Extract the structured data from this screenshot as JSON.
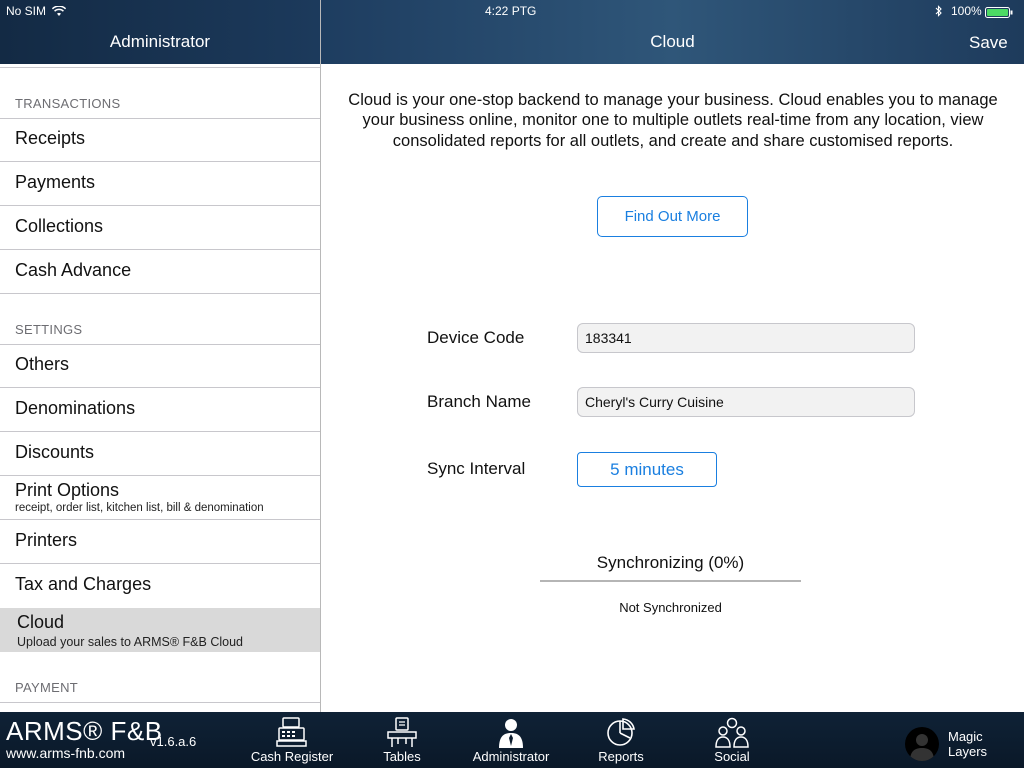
{
  "status": {
    "carrier": "No SIM",
    "time": "4:22 PTG",
    "battery": "100%"
  },
  "sidebar": {
    "title": "Administrator",
    "sections": [
      {
        "header": "TRANSACTIONS",
        "items": [
          "Receipts",
          "Payments",
          "Collections",
          "Cash Advance"
        ]
      },
      {
        "header": "SETTINGS",
        "items": [
          "Others",
          "Denominations",
          "Discounts"
        ]
      },
      {
        "header": "PAYMENT"
      }
    ],
    "print_options": {
      "label": "Print Options",
      "subtitle": "receipt, order list, kitchen list, bill & denomination"
    },
    "printers": "Printers",
    "tax": "Tax and Charges",
    "cloud": {
      "label": "Cloud",
      "subtitle": "Upload your sales to ARMS® F&B Cloud",
      "selected": true
    }
  },
  "main": {
    "title": "Cloud",
    "save_label": "Save",
    "description": "Cloud is your one-stop backend to manage your business. Cloud enables you to manage your business online, monitor one to multiple outlets real-time from any location, view consolidated reports for all outlets, and create and share customised reports.",
    "find_more_label": "Find Out More",
    "device_code_label": "Device Code",
    "device_code_value": "183341",
    "branch_name_label": "Branch Name",
    "branch_name_value": "Cheryl's Curry Cuisine",
    "sync_interval_label": "Sync Interval",
    "sync_interval_value": "5 minutes",
    "sync_title": "Synchronizing (0%)",
    "sync_progress": 0,
    "sync_status": "Not Synchronized"
  },
  "tabbar": {
    "brand": "ARMS® F&B",
    "url": "www.arms-fnb.com",
    "version": "v1.6.a.6",
    "tabs": [
      {
        "label": "Cash Register",
        "icon": "cash-register-icon"
      },
      {
        "label": "Tables",
        "icon": "tables-icon"
      },
      {
        "label": "Administrator",
        "icon": "administrator-icon"
      },
      {
        "label": "Reports",
        "icon": "reports-icon"
      },
      {
        "label": "Social",
        "icon": "social-icon"
      }
    ],
    "user": {
      "line1": "Magic",
      "line2": "Layers"
    }
  },
  "colors": {
    "accent": "#1a7fe0",
    "nav": "#1e3d60",
    "tabbar": "#0c1c2e",
    "selected_row": "#d9d9d9"
  }
}
